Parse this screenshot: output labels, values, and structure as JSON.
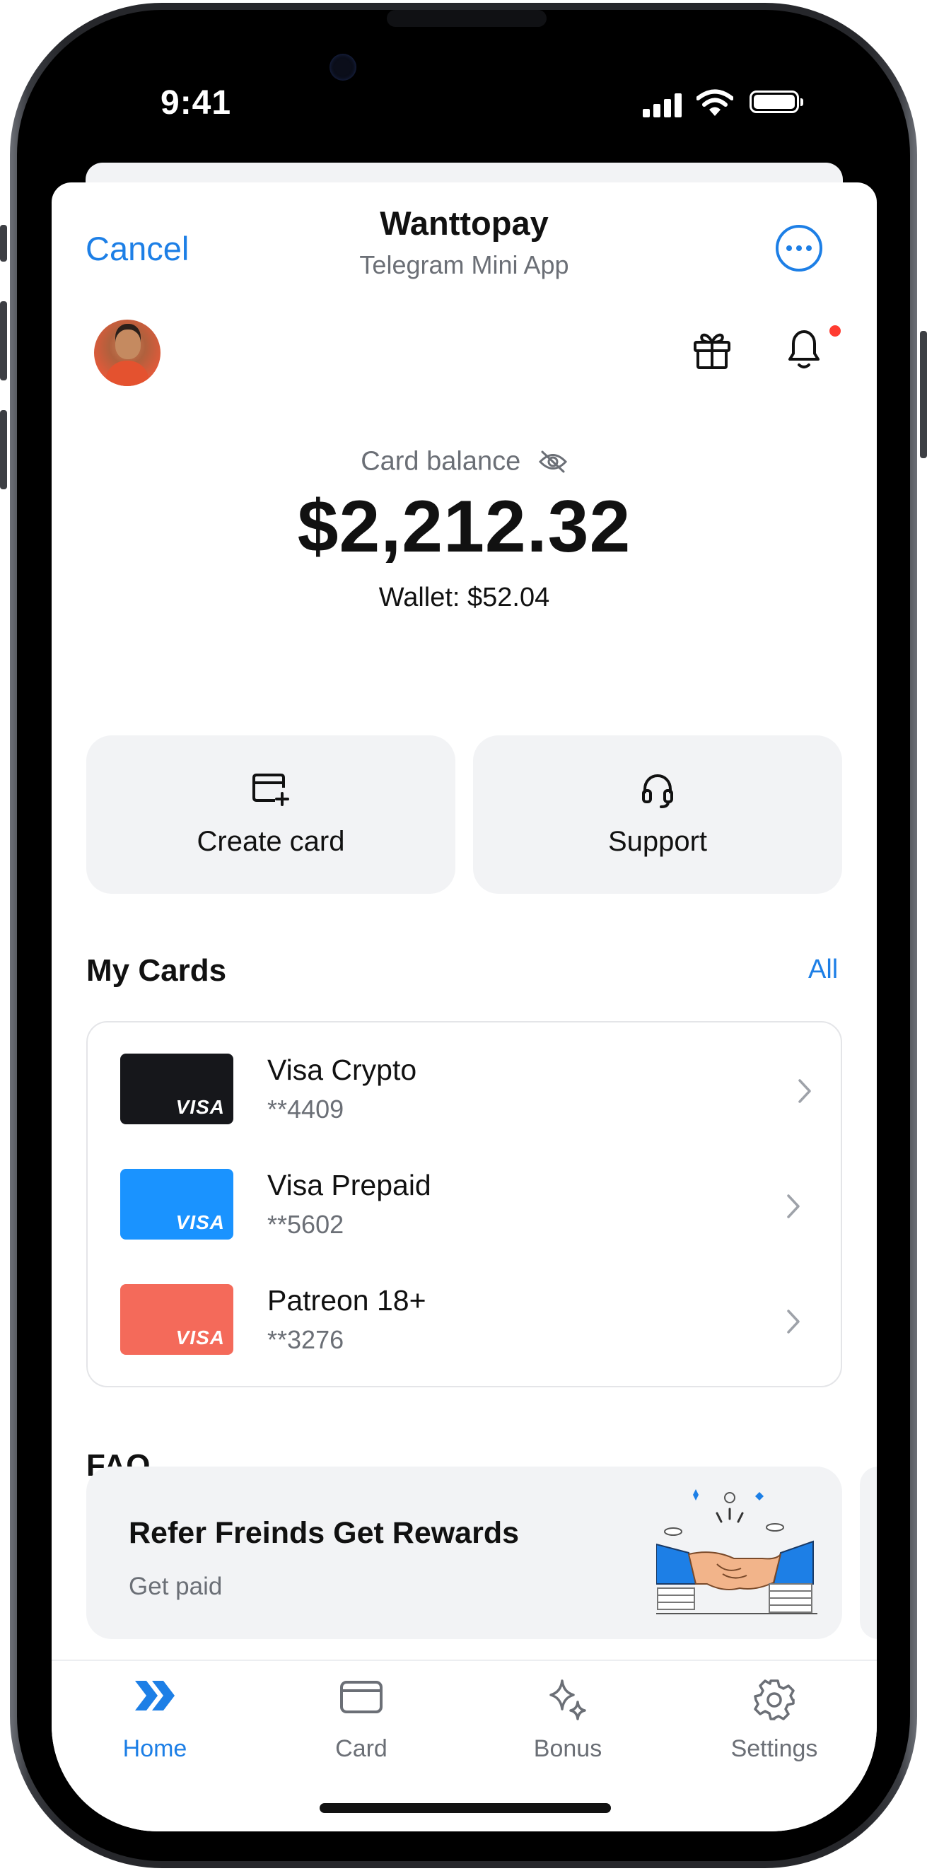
{
  "status": {
    "time": "9:41"
  },
  "header": {
    "cancel_label": "Cancel",
    "title": "Wanttopay",
    "subtitle": "Telegram Mini App"
  },
  "balance": {
    "label": "Card balance",
    "amount": "$2,212.32",
    "wallet": "Wallet: $52.04"
  },
  "actions": [
    {
      "label": "Create card",
      "icon": "card-plus-icon"
    },
    {
      "label": "Support",
      "icon": "headset-icon"
    }
  ],
  "my_cards": {
    "title": "My Cards",
    "all_label": "All",
    "items": [
      {
        "name": "Visa Crypto",
        "number": "**4409",
        "color": "#16171b",
        "brand": "VISA"
      },
      {
        "name": "Visa Prepaid",
        "number": "**5602",
        "color": "#1a93ff",
        "brand": "VISA"
      },
      {
        "name": "Patreon 18+",
        "number": "**3276",
        "color": "#f46a5a",
        "brand": "VISA"
      }
    ]
  },
  "faq": {
    "title": "FAQ",
    "card_title": "Refer Freinds Get Rewards",
    "card_subtitle": "Get paid"
  },
  "tabs": [
    {
      "label": "Home",
      "icon": "double-chevron-icon",
      "active": true
    },
    {
      "label": "Card",
      "icon": "card-icon",
      "active": false
    },
    {
      "label": "Bonus",
      "icon": "sparkles-icon",
      "active": false
    },
    {
      "label": "Settings",
      "icon": "gear-icon",
      "active": false
    }
  ],
  "colors": {
    "accent": "#1d7fe6",
    "notification": "#ff3b30",
    "surface": "#f2f3f5"
  }
}
